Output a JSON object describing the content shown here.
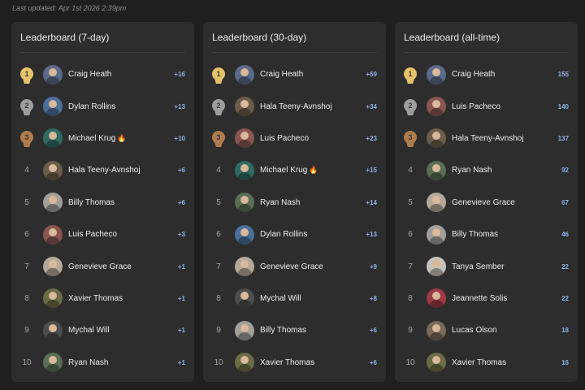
{
  "last_updated": "Last updated: Apr 1st 2026 2:39pm",
  "medal_colors": {
    "1": "#e6c36a",
    "2": "#9e9e9e",
    "3": "#b07c4d"
  },
  "boards": [
    {
      "title": "Leaderboard (7-day)",
      "rows": [
        {
          "rank": "1",
          "name": "Craig Heath",
          "fire": false,
          "score": "+16",
          "avatar": "#5b6a8a"
        },
        {
          "rank": "2",
          "name": "Dylan Rollins",
          "fire": false,
          "score": "+13",
          "avatar": "#4a6f9a"
        },
        {
          "rank": "3",
          "name": "Michael Krug",
          "fire": true,
          "score": "+10",
          "avatar": "#2f6b63"
        },
        {
          "rank": "4",
          "name": "Hala Teeny-Avnshoj",
          "fire": false,
          "score": "+6",
          "avatar": "#6b5d4a"
        },
        {
          "rank": "5",
          "name": "Billy Thomas",
          "fire": false,
          "score": "+6",
          "avatar": "#a29f99"
        },
        {
          "rank": "6",
          "name": "Luis Pacheco",
          "fire": false,
          "score": "+3",
          "avatar": "#8a5550"
        },
        {
          "rank": "7",
          "name": "Genevieve Grace",
          "fire": false,
          "score": "+1",
          "avatar": "#b4a89a"
        },
        {
          "rank": "8",
          "name": "Xavier Thomas",
          "fire": false,
          "score": "+1",
          "avatar": "#6b6b45"
        },
        {
          "rank": "9",
          "name": "Mychal Will",
          "fire": false,
          "score": "+1",
          "avatar": "#4d4d4d"
        },
        {
          "rank": "10",
          "name": "Ryan Nash",
          "fire": false,
          "score": "+1",
          "avatar": "#5a6e55"
        }
      ]
    },
    {
      "title": "Leaderboard (30-day)",
      "rows": [
        {
          "rank": "1",
          "name": "Craig Heath",
          "fire": false,
          "score": "+69",
          "avatar": "#5b6a8a"
        },
        {
          "rank": "2",
          "name": "Hala Teeny-Avnshoj",
          "fire": false,
          "score": "+34",
          "avatar": "#6b5d4a"
        },
        {
          "rank": "3",
          "name": "Luis Pacheco",
          "fire": false,
          "score": "+23",
          "avatar": "#8a5550"
        },
        {
          "rank": "4",
          "name": "Michael Krug",
          "fire": true,
          "score": "+15",
          "avatar": "#2f6b63"
        },
        {
          "rank": "5",
          "name": "Ryan Nash",
          "fire": false,
          "score": "+14",
          "avatar": "#5a6e55"
        },
        {
          "rank": "6",
          "name": "Dylan Rollins",
          "fire": false,
          "score": "+13",
          "avatar": "#4a6f9a"
        },
        {
          "rank": "7",
          "name": "Genevieve Grace",
          "fire": false,
          "score": "+9",
          "avatar": "#b4a89a"
        },
        {
          "rank": "8",
          "name": "Mychal Will",
          "fire": false,
          "score": "+8",
          "avatar": "#4d4d4d"
        },
        {
          "rank": "9",
          "name": "Billy Thomas",
          "fire": false,
          "score": "+6",
          "avatar": "#a29f99"
        },
        {
          "rank": "10",
          "name": "Xavier Thomas",
          "fire": false,
          "score": "+6",
          "avatar": "#6b6b45"
        }
      ]
    },
    {
      "title": "Leaderboard (all-time)",
      "rows": [
        {
          "rank": "1",
          "name": "Craig Heath",
          "fire": false,
          "score": "155",
          "avatar": "#5b6a8a"
        },
        {
          "rank": "2",
          "name": "Luis Pacheco",
          "fire": false,
          "score": "140",
          "avatar": "#8a5550"
        },
        {
          "rank": "3",
          "name": "Hala Teeny-Avnshoj",
          "fire": false,
          "score": "137",
          "avatar": "#6b5d4a"
        },
        {
          "rank": "4",
          "name": "Ryan Nash",
          "fire": false,
          "score": "92",
          "avatar": "#5a6e55"
        },
        {
          "rank": "5",
          "name": "Genevieve Grace",
          "fire": false,
          "score": "67",
          "avatar": "#b4a89a"
        },
        {
          "rank": "6",
          "name": "Billy Thomas",
          "fire": false,
          "score": "46",
          "avatar": "#a29f99"
        },
        {
          "rank": "7",
          "name": "Tanya Sember",
          "fire": false,
          "score": "22",
          "avatar": "#c7c2bb"
        },
        {
          "rank": "8",
          "name": "Jeannette Solis",
          "fire": false,
          "score": "22",
          "avatar": "#9c3a45"
        },
        {
          "rank": "9",
          "name": "Lucas Olson",
          "fire": false,
          "score": "18",
          "avatar": "#7a6a5c"
        },
        {
          "rank": "10",
          "name": "Xavier Thomas",
          "fire": false,
          "score": "16",
          "avatar": "#6b6b45"
        }
      ]
    }
  ]
}
